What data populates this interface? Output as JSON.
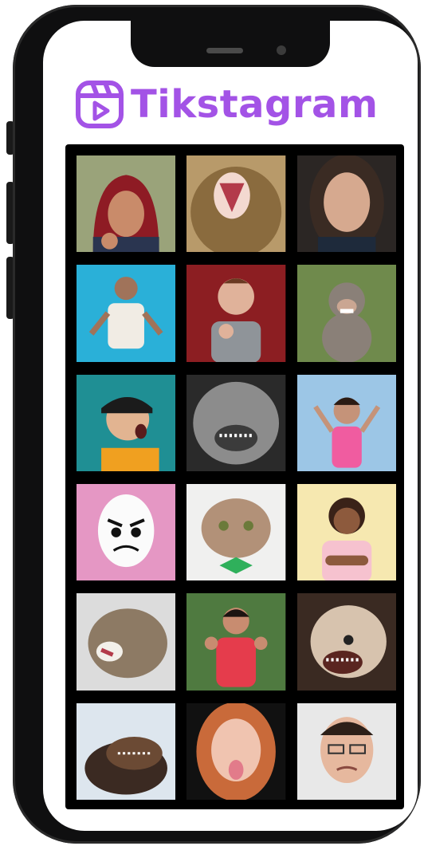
{
  "app": {
    "title": "Tikstagram",
    "brand_color": "#a353e6",
    "logo_icon": "video-reel-icon"
  },
  "grid": {
    "tiles": [
      {
        "subject": "angry-boy-hood",
        "bg": "#9aa37a"
      },
      {
        "subject": "roaring-lion",
        "bg": "#b89a6a"
      },
      {
        "subject": "frowning-girl",
        "bg": "#2b2624"
      },
      {
        "subject": "girl-hands-on-hips",
        "bg": "#2ab0d8"
      },
      {
        "subject": "boy-fist",
        "bg": "#8c1e22"
      },
      {
        "subject": "monkey",
        "bg": "#6f8a4c"
      },
      {
        "subject": "shouting-boy-cap",
        "bg": "#1f8f94"
      },
      {
        "subject": "snarling-wolf",
        "bg": "#2a2a2a"
      },
      {
        "subject": "screaming-woman",
        "bg": "#9cc6e6"
      },
      {
        "subject": "angry-egg",
        "bg": "#e597c4"
      },
      {
        "subject": "grumpy-cat-bowtie",
        "bg": "#f0f0ef"
      },
      {
        "subject": "crossed-arms-girl",
        "bg": "#f6e8b0"
      },
      {
        "subject": "hissing-cat",
        "bg": "#dcdcdc"
      },
      {
        "subject": "angry-woman-red",
        "bg": "#4f7a40"
      },
      {
        "subject": "growling-dog",
        "bg": "#3a2a22"
      },
      {
        "subject": "barking-dog",
        "bg": "#dde6ee"
      },
      {
        "subject": "girl-tongue-out",
        "bg": "#111111"
      },
      {
        "subject": "man-glasses-grimace",
        "bg": "#e8e8e8"
      }
    ]
  }
}
